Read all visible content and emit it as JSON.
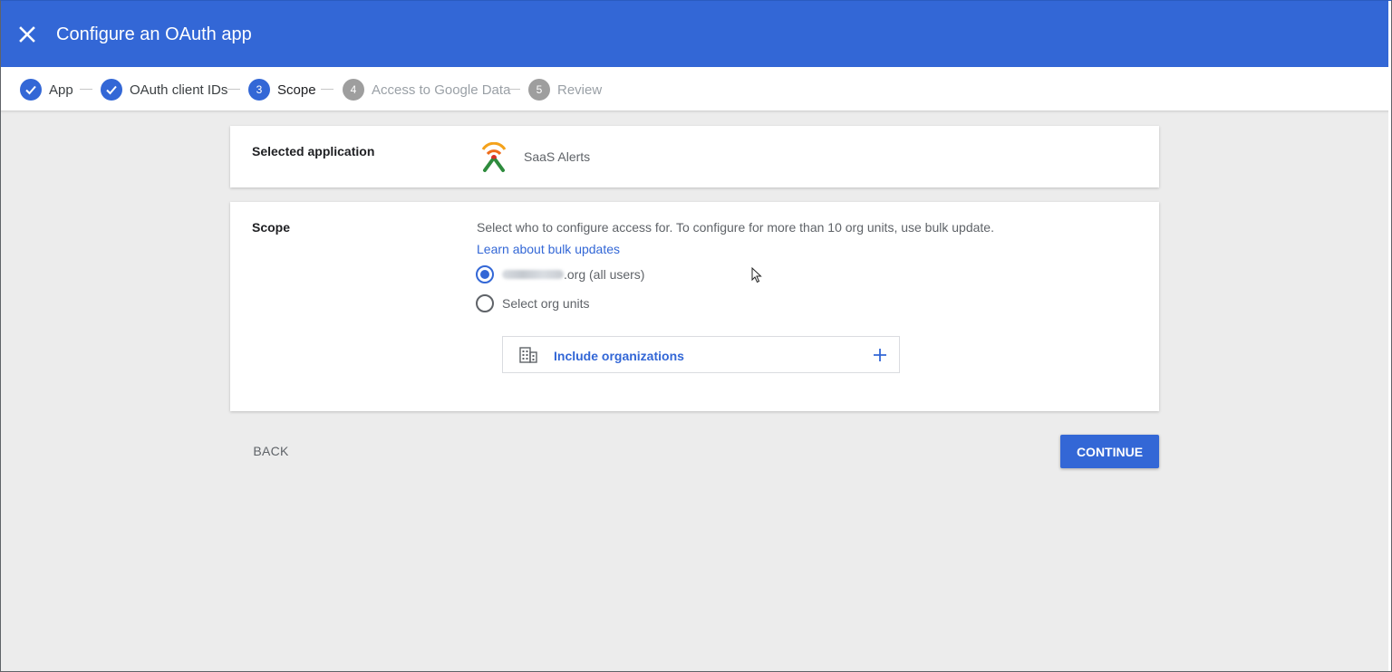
{
  "header": {
    "title": "Configure an OAuth app",
    "close_icon": "close-icon",
    "color": "#3367d6"
  },
  "stepper": {
    "steps": [
      {
        "number": "1",
        "label": "App",
        "status": "done"
      },
      {
        "number": "2",
        "label": "OAuth client IDs",
        "status": "done"
      },
      {
        "number": "3",
        "label": "Scope",
        "status": "active"
      },
      {
        "number": "4",
        "label": "Access to Google Data",
        "status": "pending"
      },
      {
        "number": "5",
        "label": "Review",
        "status": "pending"
      }
    ]
  },
  "selected_app": {
    "label": "Selected application",
    "app_name": "SaaS Alerts",
    "logo_icon": "saas-alerts-logo"
  },
  "scope": {
    "label": "Scope",
    "description": "Select who to configure access for. To configure for more than 10 org units, use bulk update.",
    "learn_link": "Learn about bulk updates",
    "options": [
      {
        "label_suffix": ".org (all users)",
        "checked": true
      },
      {
        "label": "Select org units",
        "checked": false
      }
    ],
    "include_orgs_label": "Include organizations",
    "include_icon": "building-icon",
    "add_icon": "plus-icon"
  },
  "actions": {
    "back_label": "BACK",
    "continue_label": "CONTINUE"
  }
}
